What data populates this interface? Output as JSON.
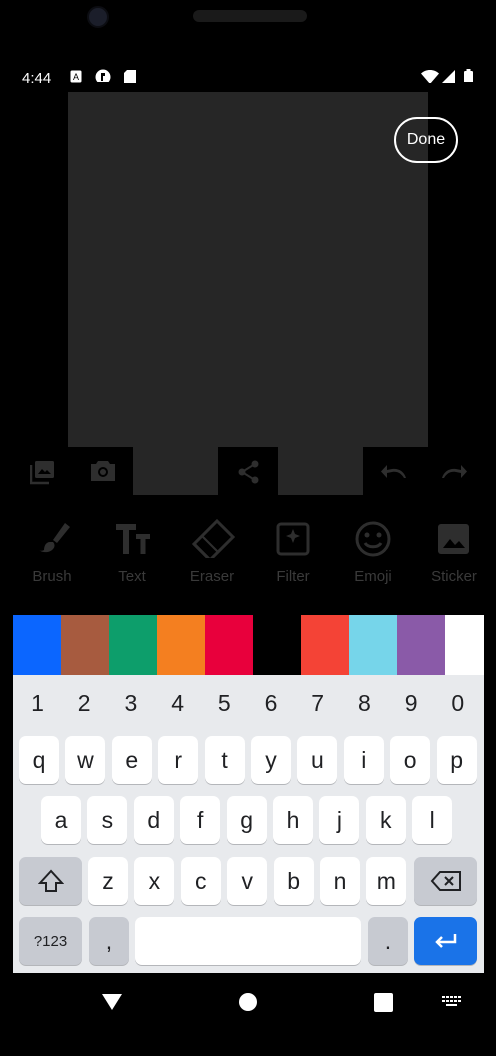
{
  "status_bar": {
    "time": "4:44",
    "icons": [
      "a-box-icon",
      "circle-app-icon",
      "sd-card-icon",
      "wifi-icon",
      "signal-icon",
      "battery-icon"
    ]
  },
  "editor": {
    "done_label": "Done",
    "top_tools": [
      "gallery-icon",
      "camera-icon",
      "share-icon",
      "undo-icon",
      "redo-icon"
    ],
    "tools": [
      {
        "label": "Brush",
        "icon": "brush-icon"
      },
      {
        "label": "Text",
        "icon": "text-icon"
      },
      {
        "label": "Eraser",
        "icon": "eraser-icon"
      },
      {
        "label": "Filter",
        "icon": "filter-icon"
      },
      {
        "label": "Emoji",
        "icon": "emoji-icon"
      },
      {
        "label": "Sticker",
        "icon": "sticker-icon"
      }
    ],
    "palette": [
      "#0b66ff",
      "#a75b3f",
      "#0d9e6b",
      "#f47f20",
      "#e8003c",
      "#000000",
      "#f44336",
      "#76d5ea",
      "#8a5aa8",
      "#ffffff"
    ]
  },
  "keyboard": {
    "numbers": [
      "1",
      "2",
      "3",
      "4",
      "5",
      "6",
      "7",
      "8",
      "9",
      "0"
    ],
    "row1": [
      "q",
      "w",
      "e",
      "r",
      "t",
      "y",
      "u",
      "i",
      "o",
      "p"
    ],
    "row2": [
      "a",
      "s",
      "d",
      "f",
      "g",
      "h",
      "j",
      "k",
      "l"
    ],
    "row3": [
      "z",
      "x",
      "c",
      "v",
      "b",
      "n",
      "m"
    ],
    "symbols_label": "?123",
    "comma": ",",
    "period": "."
  },
  "nav": [
    "back-icon",
    "home-icon",
    "recents-icon",
    "keyboard-switch-icon"
  ]
}
